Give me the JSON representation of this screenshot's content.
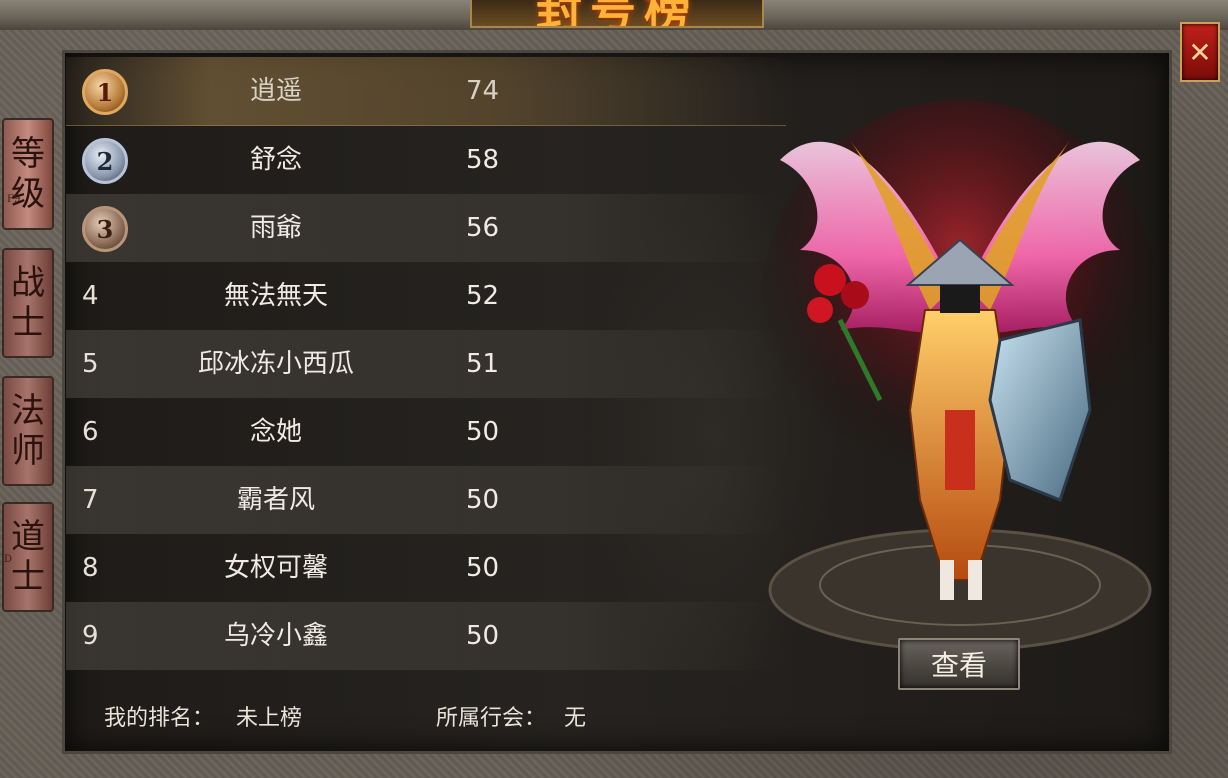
{
  "header": {
    "title": "封号榜"
  },
  "tabs": [
    {
      "label_top": "等",
      "label_bottom": "级",
      "hotkey": "F9"
    },
    {
      "label_top": "战",
      "label_bottom": "士",
      "hotkey": ""
    },
    {
      "label_top": "法",
      "label_bottom": "师",
      "hotkey": ""
    },
    {
      "label_top": "道",
      "label_bottom": "士",
      "hotkey": "D"
    }
  ],
  "ranking": [
    {
      "rank": "1",
      "name": "逍遥",
      "level": "74"
    },
    {
      "rank": "2",
      "name": "舒念",
      "level": "58"
    },
    {
      "rank": "3",
      "name": "雨爺",
      "level": "56"
    },
    {
      "rank": "4",
      "name": "無法無天",
      "level": "52"
    },
    {
      "rank": "5",
      "name": "邱冰冻小西瓜",
      "level": "51"
    },
    {
      "rank": "6",
      "name": "念她",
      "level": "50"
    },
    {
      "rank": "7",
      "name": "霸者风",
      "level": "50"
    },
    {
      "rank": "8",
      "name": "女权可馨",
      "level": "50"
    },
    {
      "rank": "9",
      "name": "乌冷小鑫",
      "level": "50"
    }
  ],
  "footer": {
    "my_rank_label": "我的排名：",
    "my_rank_value": "未上榜",
    "guild_label": "所属行会：",
    "guild_value": "无"
  },
  "buttons": {
    "view_label": "查看",
    "close_label": "✕"
  },
  "icons": {
    "close": "close-icon",
    "medal": "rank-medal-icon"
  },
  "colors": {
    "gold": "#ffb23a",
    "close_red": "#c0201a",
    "text": "#f0ebe2"
  }
}
